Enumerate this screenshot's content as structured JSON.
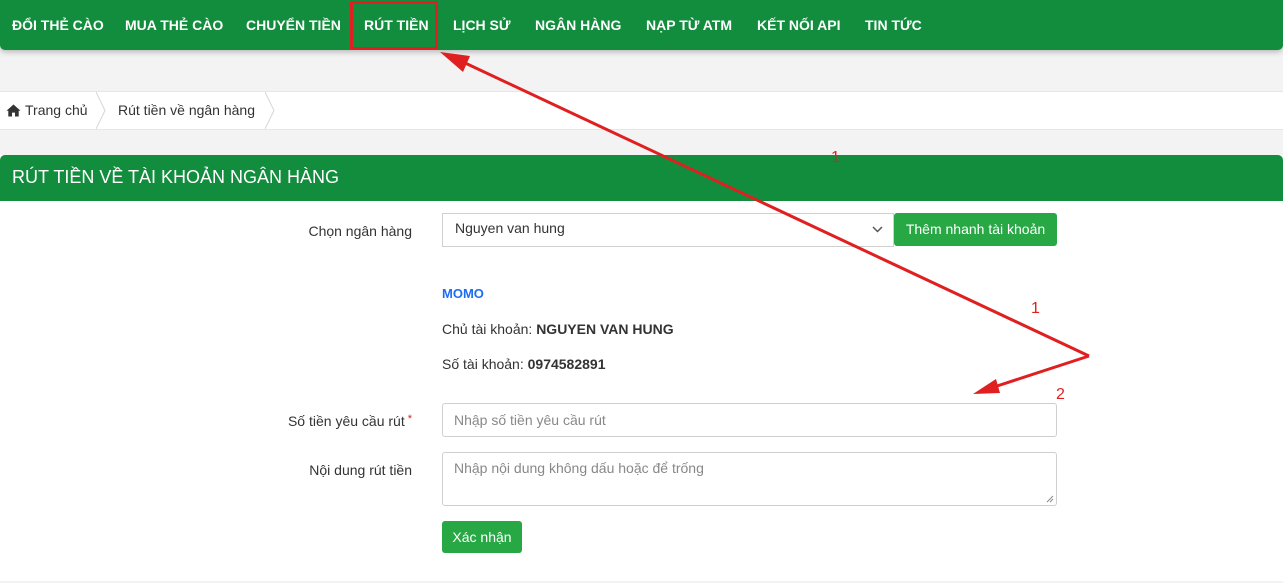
{
  "nav": {
    "items": [
      {
        "label": "ĐỔI THẺ CÀO"
      },
      {
        "label": "MUA THẺ CÀO"
      },
      {
        "label": "CHUYỂN TIỀN"
      },
      {
        "label": "RÚT TIỀN"
      },
      {
        "label": "LỊCH SỬ"
      },
      {
        "label": "NGÂN HÀNG"
      },
      {
        "label": "NẠP TỪ ATM"
      },
      {
        "label": "KẾT NỐI API"
      },
      {
        "label": "TIN TỨC"
      }
    ]
  },
  "breadcrumb": {
    "home": "Trang chủ",
    "current": "Rút tiền về ngân hàng"
  },
  "panel": {
    "title": "RÚT TIỀN VỀ TÀI KHOẢN NGÂN HÀNG"
  },
  "form": {
    "bank_label": "Chọn ngân hàng",
    "bank_selected": "Nguyen van hung",
    "quick_add_label": "Thêm nhanh tài khoản",
    "bank_name": "MOMO",
    "owner_label": "Chủ tài khoản:",
    "owner_value": "NGUYEN VAN HUNG",
    "account_label": "Số tài khoản:",
    "account_value": "0974582891",
    "amount_label": "Số tiền yêu cầu rút",
    "amount_required": "*",
    "amount_placeholder": "Nhập số tiền yêu cầu rút",
    "content_label": "Nội dung rút tiền",
    "content_placeholder": "Nhập nội dung không dấu hoặc để trống",
    "submit_label": "Xác nhận"
  },
  "annotations": {
    "label_1a": "1",
    "label_1b": "1",
    "label_2": "2"
  },
  "colors": {
    "brand_green": "#118d3d",
    "button_green": "#28a745",
    "annotation_red": "#e02020",
    "link_blue": "#1b6ef3"
  }
}
